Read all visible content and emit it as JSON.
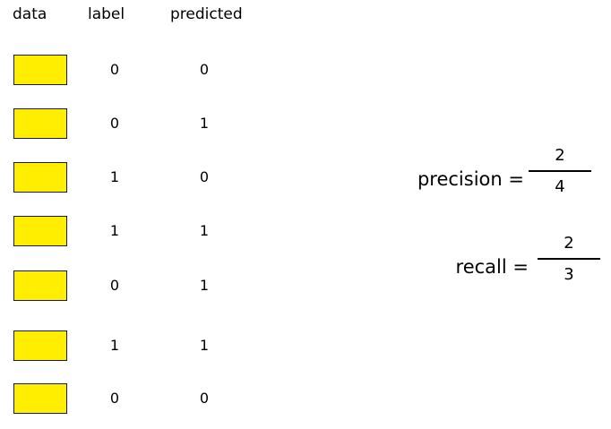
{
  "headers": {
    "data": "data",
    "label": "label",
    "predicted": "predicted"
  },
  "rows": [
    {
      "label": "0",
      "predicted": "0"
    },
    {
      "label": "0",
      "predicted": "1"
    },
    {
      "label": "1",
      "predicted": "0"
    },
    {
      "label": "1",
      "predicted": "1"
    },
    {
      "label": "0",
      "predicted": "1"
    },
    {
      "label": "1",
      "predicted": "1"
    },
    {
      "label": "0",
      "predicted": "0"
    }
  ],
  "colors": {
    "data_box_fill": "#ffee00",
    "data_box_border": "#1a1a1a"
  },
  "precision": {
    "name": "precision",
    "equals": "=",
    "numerator": "2",
    "denominator": "4"
  },
  "recall": {
    "name": "recall",
    "equals": "=",
    "numerator": "2",
    "denominator": "3"
  }
}
